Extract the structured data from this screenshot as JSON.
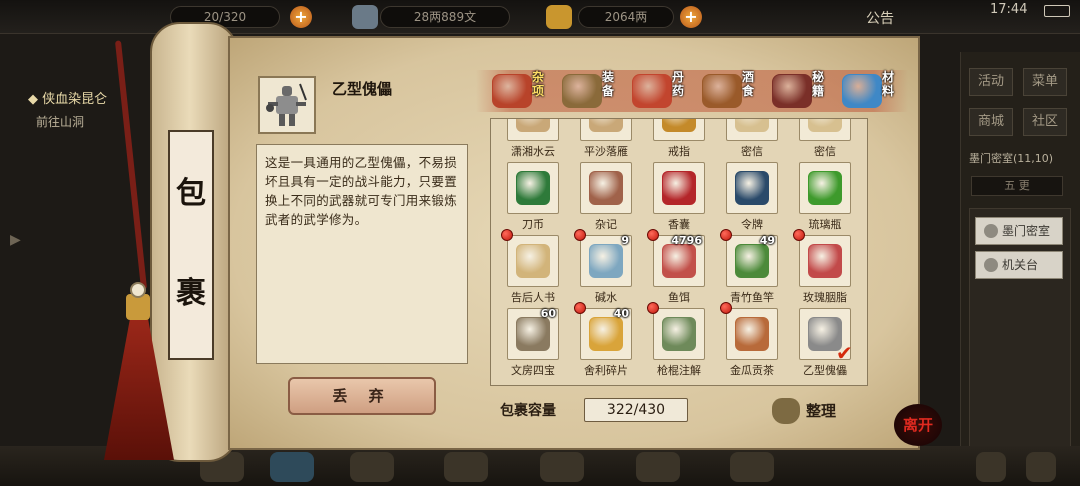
{
  "topbar": {
    "stamina": "20/320",
    "silver": "28两889文",
    "gold": "2064两",
    "notice": "公告",
    "clock": "17:44"
  },
  "quest": {
    "title": "侠血染昆仑",
    "subtitle": "前往山洞"
  },
  "scroll_label": [
    "包",
    "裹"
  ],
  "item": {
    "name": "乙型傀儡",
    "description": "这是一具通用的乙型傀儡，不易损坏且具有一定的战斗能力，只要置换上不同的武器就可专门用来锻炼武者的武学修为。",
    "discard_label": "丢 弃"
  },
  "tabs": [
    {
      "label": "杂项",
      "active": true,
      "color": "#b8432a",
      "icon": "jar-icon"
    },
    {
      "label": "装备",
      "active": false,
      "color": "#8a6a3a",
      "icon": "weapons-icon"
    },
    {
      "label": "丹药",
      "active": false,
      "color": "#c2452e",
      "icon": "pills-icon"
    },
    {
      "label": "酒食",
      "active": false,
      "color": "#9a5a2a",
      "icon": "food-icon"
    },
    {
      "label": "秘籍",
      "active": false,
      "color": "#7a2f28",
      "icon": "book-icon"
    },
    {
      "label": "材料",
      "active": false,
      "color": "#3f88c6",
      "icon": "crystal-icon"
    }
  ],
  "items": [
    {
      "name": "潇湘水云",
      "count": "",
      "dot": false,
      "check": false,
      "color": "#c9a878",
      "icon": "scroll-icon"
    },
    {
      "name": "平沙落雁",
      "count": "",
      "dot": false,
      "check": false,
      "color": "#c9a878",
      "icon": "scroll-icon"
    },
    {
      "name": "戒指",
      "count": "",
      "dot": false,
      "check": false,
      "color": "#c48a2a",
      "icon": "ring-icon"
    },
    {
      "name": "密信",
      "count": "",
      "dot": false,
      "check": false,
      "color": "#d7c090",
      "icon": "letter-icon"
    },
    {
      "name": "密信",
      "count": "",
      "dot": false,
      "check": false,
      "color": "#d7c090",
      "icon": "letter-icon"
    },
    {
      "name": "刀币",
      "count": "",
      "dot": false,
      "check": false,
      "color": "#2e7a3a",
      "icon": "knife-coin-icon"
    },
    {
      "name": "杂记",
      "count": "",
      "dot": false,
      "check": false,
      "color": "#a0624a",
      "icon": "scroll-icon"
    },
    {
      "name": "香囊",
      "count": "",
      "dot": false,
      "check": false,
      "color": "#b4262a",
      "icon": "sachet-icon"
    },
    {
      "name": "令牌",
      "count": "",
      "dot": false,
      "check": false,
      "color": "#2a4a6a",
      "icon": "token-icon"
    },
    {
      "name": "琉璃瓶",
      "count": "",
      "dot": false,
      "check": false,
      "color": "#3e9a2c",
      "icon": "bottle-icon"
    },
    {
      "name": "告后人书",
      "count": "",
      "dot": true,
      "check": false,
      "color": "#d2b47a",
      "icon": "letter-icon"
    },
    {
      "name": "碱水",
      "count": "9",
      "dot": true,
      "check": false,
      "color": "#7ea7c0",
      "icon": "bowl-icon"
    },
    {
      "name": "鱼饵",
      "count": "4796",
      "dot": true,
      "check": false,
      "color": "#c2504a",
      "icon": "worm-icon"
    },
    {
      "name": "青竹鱼竿",
      "count": "49",
      "dot": true,
      "check": false,
      "color": "#4c8a3a",
      "icon": "fishing-rod-icon"
    },
    {
      "name": "玫瑰胭脂",
      "count": "",
      "dot": true,
      "check": false,
      "color": "#c24a4a",
      "icon": "rouge-icon"
    },
    {
      "name": "文房四宝",
      "count": "60",
      "dot": false,
      "check": false,
      "color": "#8a7a60",
      "icon": "brush-icon"
    },
    {
      "name": "舍利碎片",
      "count": "40",
      "dot": true,
      "check": false,
      "color": "#d9a43a",
      "icon": "relic-icon"
    },
    {
      "name": "枪棍注解",
      "count": "",
      "dot": true,
      "check": false,
      "color": "#6e8a5a",
      "icon": "book-icon"
    },
    {
      "name": "金瓜贡茶",
      "count": "",
      "dot": true,
      "check": false,
      "color": "#b86a3a",
      "icon": "tea-icon"
    },
    {
      "name": "乙型傀儡",
      "count": "",
      "dot": false,
      "check": true,
      "color": "#8a8a8a",
      "icon": "puppet-icon"
    }
  ],
  "capacity": {
    "label": "包裹容量",
    "value": "322/430"
  },
  "sort_label": "整理",
  "leave_label": "离开",
  "side": {
    "buttons": [
      "活动",
      "菜单",
      "商城",
      "社区"
    ],
    "location": "墨门密室",
    "coords": "(11,10)",
    "hour": "五 更",
    "poi1": "墨门密室",
    "poi2": "机关台"
  }
}
